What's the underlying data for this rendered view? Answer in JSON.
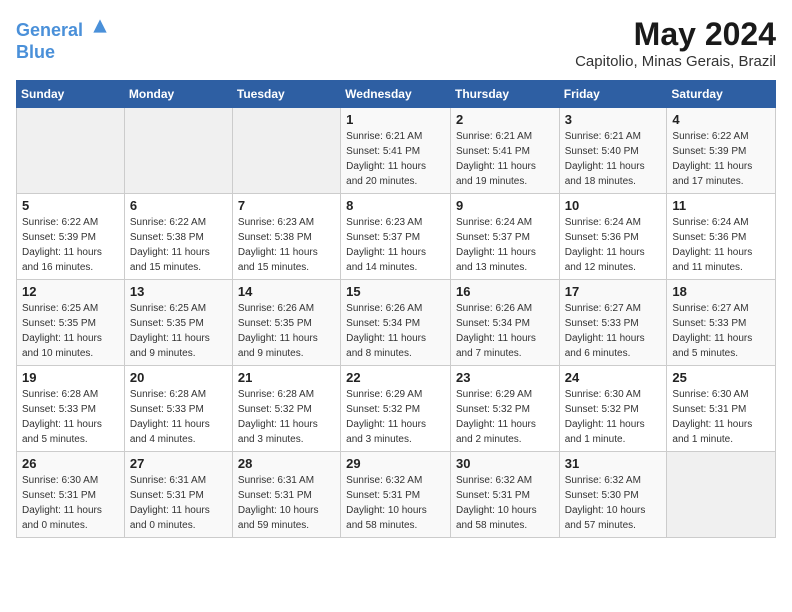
{
  "header": {
    "logo_line1": "General",
    "logo_line2": "Blue",
    "month_year": "May 2024",
    "location": "Capitolio, Minas Gerais, Brazil"
  },
  "weekdays": [
    "Sunday",
    "Monday",
    "Tuesday",
    "Wednesday",
    "Thursday",
    "Friday",
    "Saturday"
  ],
  "weeks": [
    [
      {
        "day": "",
        "info": ""
      },
      {
        "day": "",
        "info": ""
      },
      {
        "day": "",
        "info": ""
      },
      {
        "day": "1",
        "info": "Sunrise: 6:21 AM\nSunset: 5:41 PM\nDaylight: 11 hours and 20 minutes."
      },
      {
        "day": "2",
        "info": "Sunrise: 6:21 AM\nSunset: 5:41 PM\nDaylight: 11 hours and 19 minutes."
      },
      {
        "day": "3",
        "info": "Sunrise: 6:21 AM\nSunset: 5:40 PM\nDaylight: 11 hours and 18 minutes."
      },
      {
        "day": "4",
        "info": "Sunrise: 6:22 AM\nSunset: 5:39 PM\nDaylight: 11 hours and 17 minutes."
      }
    ],
    [
      {
        "day": "5",
        "info": "Sunrise: 6:22 AM\nSunset: 5:39 PM\nDaylight: 11 hours and 16 minutes."
      },
      {
        "day": "6",
        "info": "Sunrise: 6:22 AM\nSunset: 5:38 PM\nDaylight: 11 hours and 15 minutes."
      },
      {
        "day": "7",
        "info": "Sunrise: 6:23 AM\nSunset: 5:38 PM\nDaylight: 11 hours and 15 minutes."
      },
      {
        "day": "8",
        "info": "Sunrise: 6:23 AM\nSunset: 5:37 PM\nDaylight: 11 hours and 14 minutes."
      },
      {
        "day": "9",
        "info": "Sunrise: 6:24 AM\nSunset: 5:37 PM\nDaylight: 11 hours and 13 minutes."
      },
      {
        "day": "10",
        "info": "Sunrise: 6:24 AM\nSunset: 5:36 PM\nDaylight: 11 hours and 12 minutes."
      },
      {
        "day": "11",
        "info": "Sunrise: 6:24 AM\nSunset: 5:36 PM\nDaylight: 11 hours and 11 minutes."
      }
    ],
    [
      {
        "day": "12",
        "info": "Sunrise: 6:25 AM\nSunset: 5:35 PM\nDaylight: 11 hours and 10 minutes."
      },
      {
        "day": "13",
        "info": "Sunrise: 6:25 AM\nSunset: 5:35 PM\nDaylight: 11 hours and 9 minutes."
      },
      {
        "day": "14",
        "info": "Sunrise: 6:26 AM\nSunset: 5:35 PM\nDaylight: 11 hours and 9 minutes."
      },
      {
        "day": "15",
        "info": "Sunrise: 6:26 AM\nSunset: 5:34 PM\nDaylight: 11 hours and 8 minutes."
      },
      {
        "day": "16",
        "info": "Sunrise: 6:26 AM\nSunset: 5:34 PM\nDaylight: 11 hours and 7 minutes."
      },
      {
        "day": "17",
        "info": "Sunrise: 6:27 AM\nSunset: 5:33 PM\nDaylight: 11 hours and 6 minutes."
      },
      {
        "day": "18",
        "info": "Sunrise: 6:27 AM\nSunset: 5:33 PM\nDaylight: 11 hours and 5 minutes."
      }
    ],
    [
      {
        "day": "19",
        "info": "Sunrise: 6:28 AM\nSunset: 5:33 PM\nDaylight: 11 hours and 5 minutes."
      },
      {
        "day": "20",
        "info": "Sunrise: 6:28 AM\nSunset: 5:33 PM\nDaylight: 11 hours and 4 minutes."
      },
      {
        "day": "21",
        "info": "Sunrise: 6:28 AM\nSunset: 5:32 PM\nDaylight: 11 hours and 3 minutes."
      },
      {
        "day": "22",
        "info": "Sunrise: 6:29 AM\nSunset: 5:32 PM\nDaylight: 11 hours and 3 minutes."
      },
      {
        "day": "23",
        "info": "Sunrise: 6:29 AM\nSunset: 5:32 PM\nDaylight: 11 hours and 2 minutes."
      },
      {
        "day": "24",
        "info": "Sunrise: 6:30 AM\nSunset: 5:32 PM\nDaylight: 11 hours and 1 minute."
      },
      {
        "day": "25",
        "info": "Sunrise: 6:30 AM\nSunset: 5:31 PM\nDaylight: 11 hours and 1 minute."
      }
    ],
    [
      {
        "day": "26",
        "info": "Sunrise: 6:30 AM\nSunset: 5:31 PM\nDaylight: 11 hours and 0 minutes."
      },
      {
        "day": "27",
        "info": "Sunrise: 6:31 AM\nSunset: 5:31 PM\nDaylight: 11 hours and 0 minutes."
      },
      {
        "day": "28",
        "info": "Sunrise: 6:31 AM\nSunset: 5:31 PM\nDaylight: 10 hours and 59 minutes."
      },
      {
        "day": "29",
        "info": "Sunrise: 6:32 AM\nSunset: 5:31 PM\nDaylight: 10 hours and 58 minutes."
      },
      {
        "day": "30",
        "info": "Sunrise: 6:32 AM\nSunset: 5:31 PM\nDaylight: 10 hours and 58 minutes."
      },
      {
        "day": "31",
        "info": "Sunrise: 6:32 AM\nSunset: 5:30 PM\nDaylight: 10 hours and 57 minutes."
      },
      {
        "day": "",
        "info": ""
      }
    ]
  ]
}
